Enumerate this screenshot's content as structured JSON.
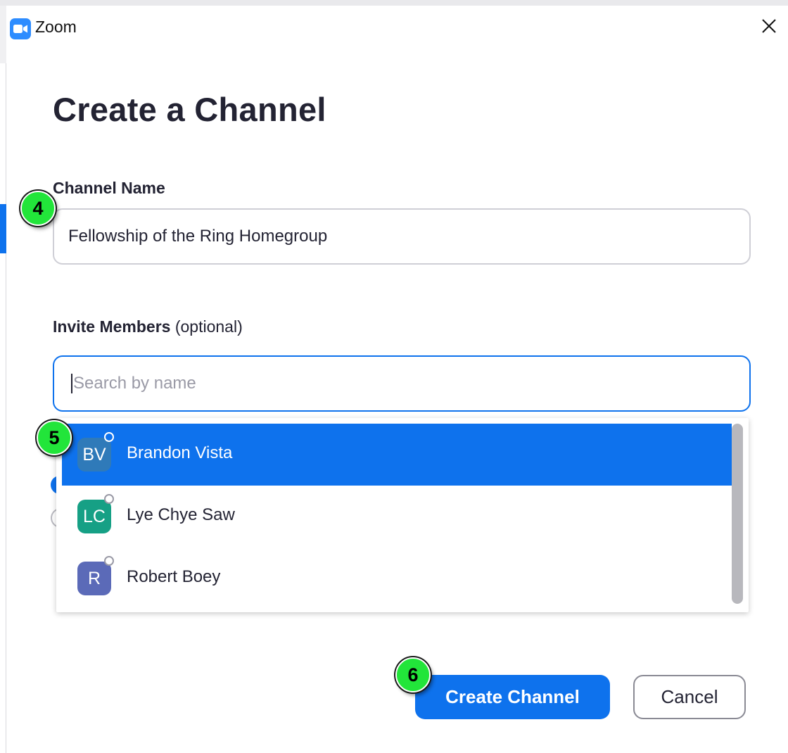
{
  "window": {
    "app_title": "Zoom"
  },
  "dialog": {
    "title": "Create a Channel",
    "channel_name": {
      "label": "Channel Name",
      "value": "Fellowship of the Ring Homegroup"
    },
    "invite": {
      "label": "Invite Members",
      "optional": "(optional)",
      "placeholder": "Search by name"
    },
    "members": [
      {
        "initials": "BV",
        "name": "Brandon Vista",
        "color": "#2f7ab9",
        "selected": true
      },
      {
        "initials": "LC",
        "name": "Lye Chye Saw",
        "color": "#16a085",
        "selected": false
      },
      {
        "initials": "R",
        "name": "Robert Boey",
        "color": "#5b6ab8",
        "selected": false
      }
    ],
    "buttons": {
      "create": "Create Channel",
      "cancel": "Cancel"
    }
  },
  "annotations": {
    "step4": "4",
    "step5": "5",
    "step6": "6"
  },
  "colors": {
    "accent": "#0e72ed",
    "step_badge": "#22e53a"
  }
}
